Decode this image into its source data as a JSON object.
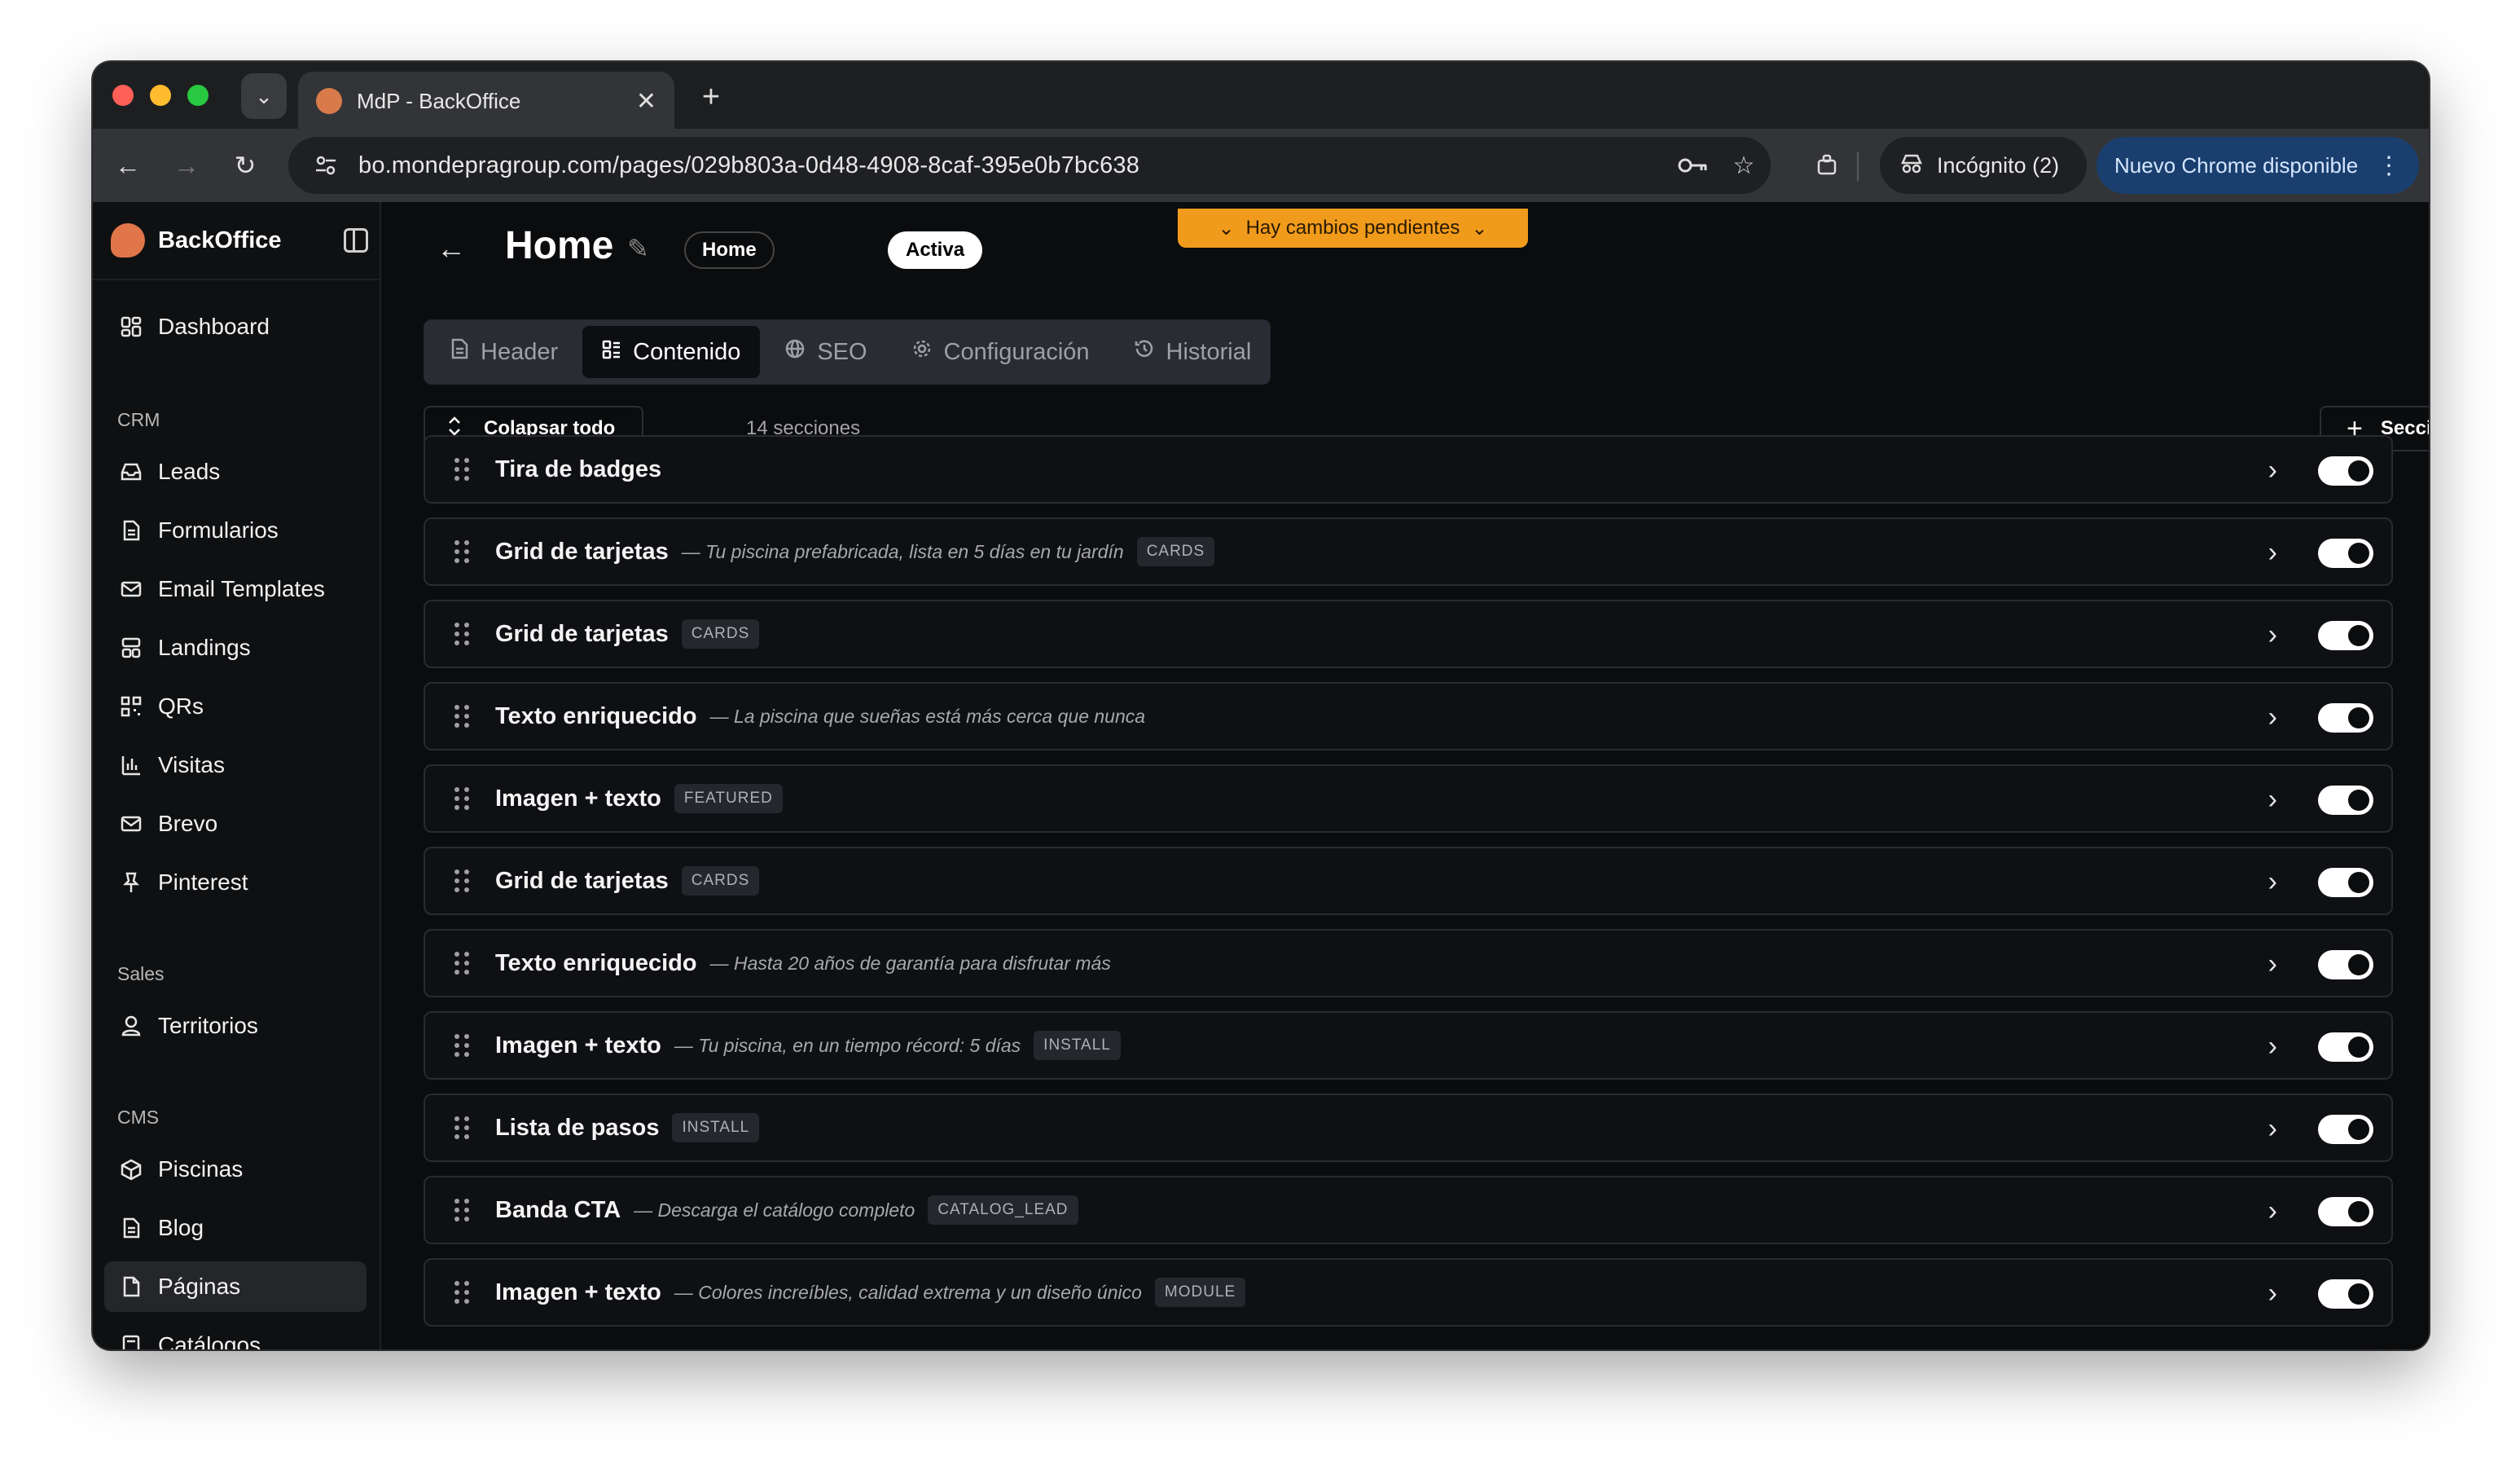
{
  "browser": {
    "tab_title": "MdP - BackOffice",
    "url": "bo.mondepragroup.com/pages/029b803a-0d48-4908-8caf-395e0b7bc638",
    "incognito_label": "Incógnito (2)",
    "update_label": "Nuevo Chrome disponible"
  },
  "sidebar": {
    "brand": "BackOffice",
    "dashboard": "Dashboard",
    "groups": {
      "crm": "CRM",
      "sales": "Sales",
      "cms": "CMS"
    },
    "crm_items": [
      "Leads",
      "Formularios",
      "Email Templates",
      "Landings",
      "QRs",
      "Visitas",
      "Brevo",
      "Pinterest"
    ],
    "sales_items": [
      "Territorios"
    ],
    "cms_items": [
      "Piscinas",
      "Blog",
      "Páginas",
      "Catálogos"
    ],
    "active_item": "Páginas"
  },
  "page": {
    "title": "Home",
    "chip_home": "Home",
    "chip_status": "Activa",
    "pending_banner": "Hay cambios pendientes",
    "tabs": [
      "Header",
      "Contenido",
      "SEO",
      "Configuración",
      "Historial"
    ],
    "selected_tab": "Contenido",
    "collapse_all": "Colapsar todo",
    "section_count": "14 secciones",
    "add_section": "Sección"
  },
  "sections": [
    {
      "title": "Tira de badges",
      "subtitle": "",
      "badge": "",
      "enabled": true
    },
    {
      "title": "Grid de tarjetas",
      "subtitle": "— Tu piscina prefabricada, lista en 5 días en tu jardín",
      "badge": "CARDS",
      "enabled": true
    },
    {
      "title": "Grid de tarjetas",
      "subtitle": "",
      "badge": "CARDS",
      "enabled": true
    },
    {
      "title": "Texto enriquecido",
      "subtitle": "— La piscina que sueñas está más cerca que nunca",
      "badge": "",
      "enabled": true
    },
    {
      "title": "Imagen + texto",
      "subtitle": "",
      "badge": "FEATURED",
      "enabled": true
    },
    {
      "title": "Grid de tarjetas",
      "subtitle": "",
      "badge": "CARDS",
      "enabled": true
    },
    {
      "title": "Texto enriquecido",
      "subtitle": "— Hasta 20 años de garantía para disfrutar más",
      "badge": "",
      "enabled": true
    },
    {
      "title": "Imagen + texto",
      "subtitle": "— Tu piscina, en un tiempo récord: 5 días",
      "badge": "INSTALL",
      "enabled": true
    },
    {
      "title": "Lista de pasos",
      "subtitle": "",
      "badge": "INSTALL",
      "enabled": true
    },
    {
      "title": "Banda CTA",
      "subtitle": "— Descarga el catálogo completo",
      "badge": "CATALOG_LEAD",
      "enabled": true
    },
    {
      "title": "Imagen + texto",
      "subtitle": "— Colores increíbles, calidad extrema y un diseño único",
      "badge": "MODULE",
      "enabled": true
    }
  ]
}
